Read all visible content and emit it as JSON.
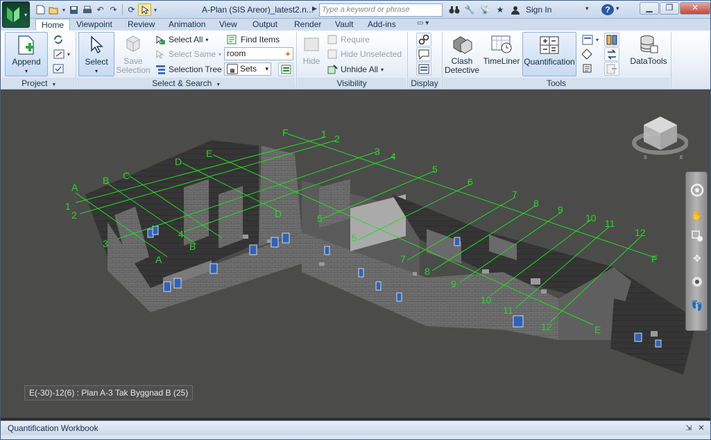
{
  "window": {
    "title": "A-Plan (SIS Areor)_latest2.n...",
    "search_placeholder": "Type a keyword or phrase",
    "sign_in": "Sign In"
  },
  "tabs": [
    {
      "label": "Home",
      "active": true
    },
    {
      "label": "Viewpoint"
    },
    {
      "label": "Review"
    },
    {
      "label": "Animation"
    },
    {
      "label": "View"
    },
    {
      "label": "Output"
    },
    {
      "label": "Render"
    },
    {
      "label": "Vault"
    },
    {
      "label": "Add-ins"
    }
  ],
  "ribbon": {
    "project": {
      "title": "Project",
      "append_label": "Append"
    },
    "select_search": {
      "title": "Select & Search",
      "select_label": "Select",
      "save_selection_label": "Save\nSelection",
      "select_all": "Select All",
      "select_same": "Select Same",
      "selection_tree": "Selection Tree",
      "find_items": "Find Items",
      "search_value": "room",
      "sets_label": "Sets"
    },
    "visibility": {
      "title": "Visibility",
      "hide_label": "Hide",
      "require": "Require",
      "hide_unselected": "Hide Unselected",
      "unhide_all": "Unhide All"
    },
    "display": {
      "title": "Display"
    },
    "tools": {
      "title": "Tools",
      "clash_detective": "Clash\nDetective",
      "timeliner": "TimeLiner",
      "quantification": "Quantification",
      "datatools": "DataTools"
    }
  },
  "viewport": {
    "status_text": "E(-30)-12(6) : Plan A-3 Tak Byggnad B (25)",
    "grid_color": "#22dd22",
    "grid_labels": {
      "letters_left": [
        "A",
        "B",
        "C",
        "D",
        "E",
        "F"
      ],
      "numbers_top": [
        "1",
        "2",
        "3",
        "4",
        "5",
        "6",
        "7",
        "8",
        "9",
        "10",
        "11",
        "12"
      ],
      "numbers_left": [
        "1",
        "2",
        "3"
      ],
      "letters_inner": [
        "A",
        "B",
        "D"
      ],
      "numbers_inner": [
        "4",
        "5",
        "5",
        "7",
        "8",
        "9",
        "10",
        "11",
        "12"
      ],
      "letters_right": [
        "F",
        "E"
      ]
    }
  },
  "workbook": {
    "title": "Quantification Workbook"
  },
  "icons": {
    "app": "navisworks-logo-icon",
    "accent": "#ffe79a",
    "brand_green": "#1d5a3f"
  }
}
